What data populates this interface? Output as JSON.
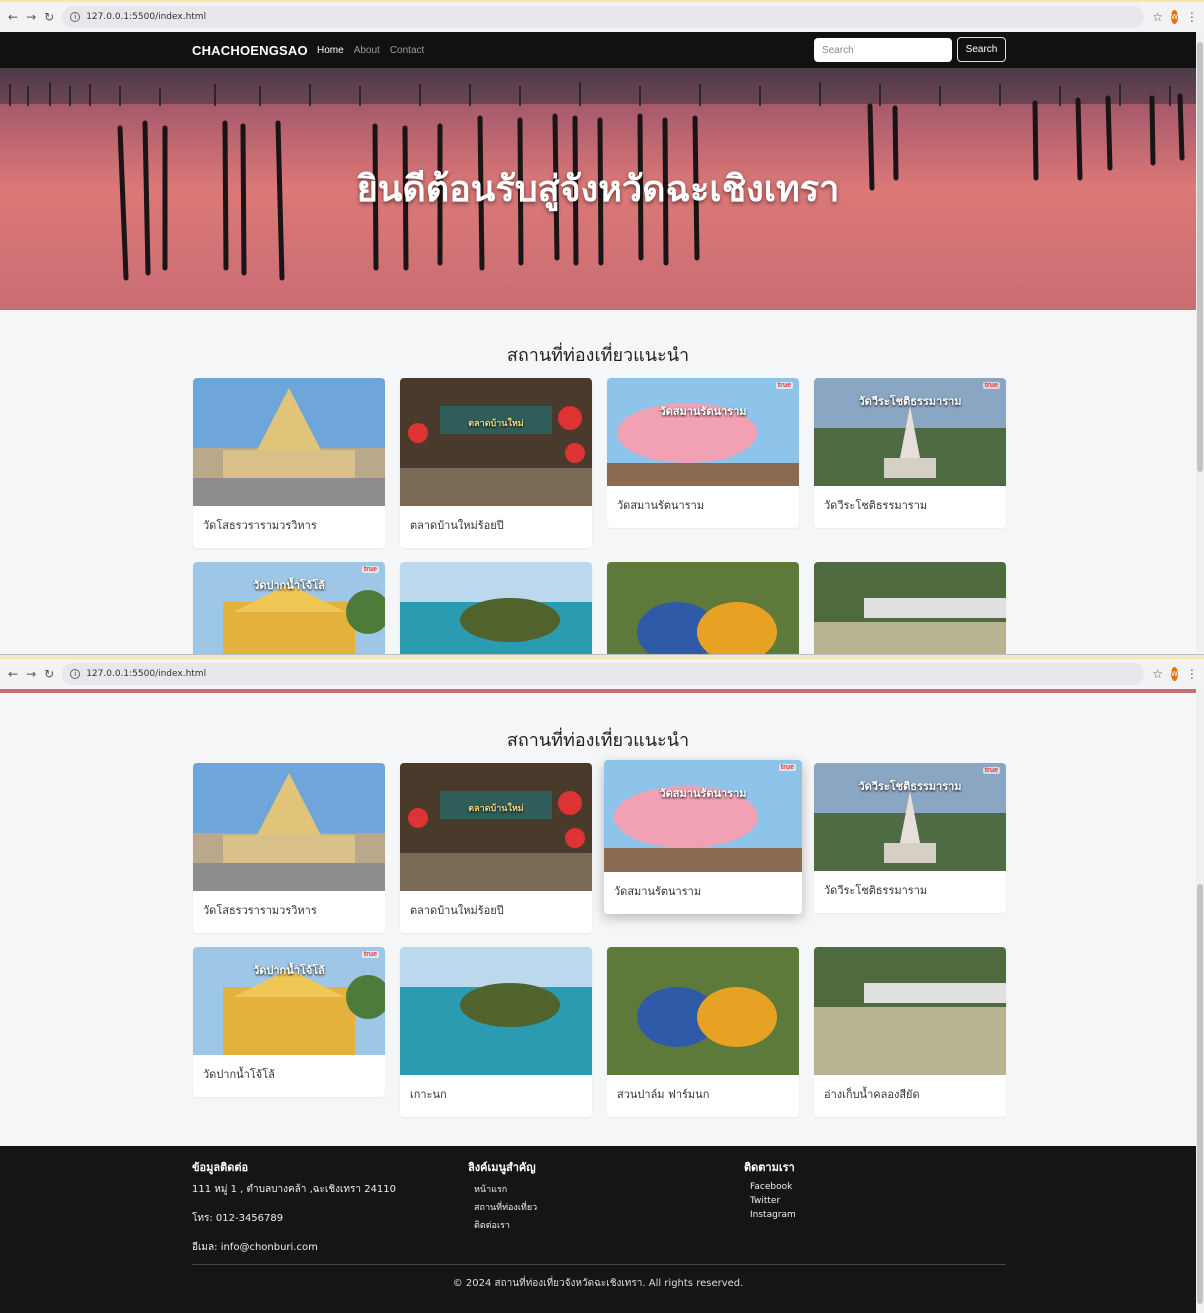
{
  "browser": {
    "url": "127.0.0.1:5500/index.html",
    "avatar_letter": "W"
  },
  "navbar": {
    "brand": "CHACHOENGSAO",
    "links": [
      "Home",
      "About",
      "Contact"
    ],
    "search_placeholder": "Search",
    "search_button": "Search"
  },
  "hero": {
    "title": "ยินดีต้อนรับสู่จังหวัดฉะเชิงเทรา"
  },
  "section": {
    "title": "สถานที่ท่องเที่ยวแนะนำ"
  },
  "cards": [
    {
      "caption": "วัดโสธรวรารามวรวิหาร",
      "overlay": "",
      "badge": ""
    },
    {
      "caption": "ตลาดบ้านใหม่ร้อยปี",
      "overlay": "ตลาดบ้านใหม่",
      "badge": ""
    },
    {
      "caption": "วัดสมานรัตนาราม",
      "overlay": "วัดสมานรัตนาราม",
      "badge": "true"
    },
    {
      "caption": "วัดวีระโชติธรรมาราม",
      "overlay": "วัดวีระโชติธรรมาราม",
      "badge": "true"
    },
    {
      "caption": "วัดปากน้ำโจ้โล้",
      "overlay": "วัดปากน้ำโจ้โล้",
      "badge": "true"
    },
    {
      "caption": "เกาะนก",
      "overlay": "",
      "badge": ""
    },
    {
      "caption": "สวนปาล์ม ฟาร์มนก",
      "overlay": "",
      "badge": ""
    },
    {
      "caption": "อ่างเก็บน้ำคลองสียัด",
      "overlay": "",
      "badge": ""
    }
  ],
  "footer": {
    "contact_title": "ข้อมูลติดต่อ",
    "address": "111 หมู่ 1 , ตำบลบางคล้า ,ฉะเชิงเทรา 24110",
    "phone": "โทร: 012-3456789",
    "email": "อีเมล: info@chonburi.com",
    "menu_title": "ลิงค์เมนูสำคัญ",
    "menu": [
      "หน้าแรก",
      "สถานที่ท่องเที่ยว",
      "ติดต่อเรา"
    ],
    "follow_title": "ติดตามเรา",
    "social": [
      "Facebook",
      "Twitter",
      "Instagram"
    ],
    "copyright": "© 2024 สถานที่ท่องเที่ยวจังหวัดฉะเชิงเทรา. All rights reserved."
  }
}
